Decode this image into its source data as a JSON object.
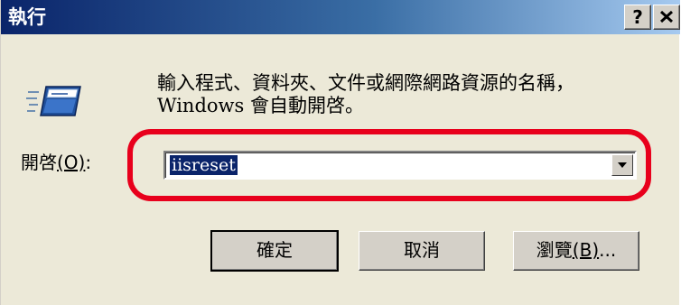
{
  "window": {
    "title": "執行",
    "help_label": "?"
  },
  "description": {
    "line1": "輸入程式、資料夾、文件或網際網路資源的名稱，",
    "line2": "Windows 會自動開啓。"
  },
  "open_field": {
    "label": "開啓",
    "accel_text": "(O)",
    "label_suffix": ":",
    "value": "iisreset"
  },
  "buttons": {
    "ok": "確定",
    "cancel": "取消",
    "browse": "瀏覽",
    "browse_accel": "(B)",
    "browse_suffix": "..."
  },
  "icons": {
    "run": "run-program-icon",
    "close": "close-icon",
    "dropdown": "chevron-down-icon"
  },
  "colors": {
    "titlebar_start": "#0a246a",
    "titlebar_end": "#a6caf0",
    "highlight_ring": "#e8001c",
    "selection": "#0a246a"
  }
}
